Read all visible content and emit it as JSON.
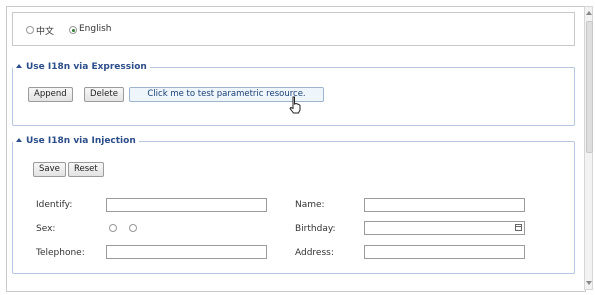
{
  "language": {
    "options": [
      {
        "label": "中文",
        "selected": false
      },
      {
        "label": "English",
        "selected": true
      }
    ]
  },
  "expression_panel": {
    "title": "Use I18n via Expression",
    "buttons": {
      "append": "Append",
      "delete": "Delete",
      "test": "Click me to test parametric resource."
    }
  },
  "injection_panel": {
    "title": "Use I18n via Injection",
    "buttons": {
      "save": "Save",
      "reset": "Reset"
    },
    "fields": {
      "identify": {
        "label": "Identify:",
        "value": ""
      },
      "sex": {
        "label": "Sex:"
      },
      "telephone": {
        "label": "Telephone:",
        "value": ""
      },
      "name": {
        "label": "Name:",
        "value": ""
      },
      "birthday": {
        "label": "Birthday:",
        "value": ""
      },
      "address": {
        "label": "Address:",
        "value": ""
      }
    }
  },
  "colors": {
    "panel_border": "#b7c7e3",
    "panel_title": "#2b4d8a",
    "selected_radio": "#2e7d32"
  }
}
